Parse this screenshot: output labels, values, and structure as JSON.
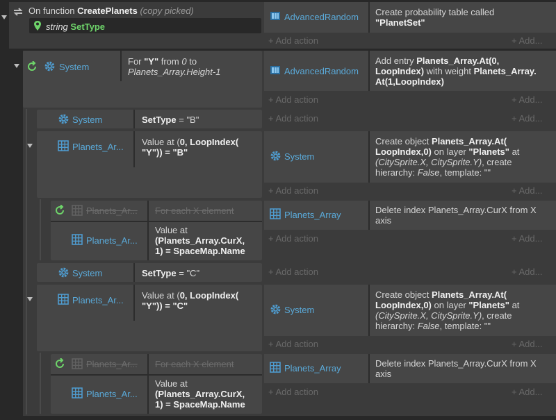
{
  "function_header": {
    "prefix": "On function ",
    "name": "CreatePlanets",
    "suffix": "(copy picked)",
    "param_type": "string",
    "param_name": "SetType",
    "action_object": "AdvancedRandom",
    "action_pre": "Create probability table called",
    "action_value": "\"PlanetSet\""
  },
  "add_action": "+ Add action",
  "add_dots": "+ Add...",
  "loop_event": {
    "object": "System",
    "c_pre": "For ",
    "c_var": "\"Y\"",
    "c_from": " from ",
    "c_zero": "0",
    "c_to": " to",
    "c_end": "Planets_Array.Height-1",
    "action_object": "AdvancedRandom",
    "a1_pre": "Add entry ",
    "a1_b": "Planets_Array.At(0,",
    "a2_b1": "LoopIndex)",
    "a2_mid": " with weight ",
    "a2_b2": "Planets_Array.",
    "a3_b": "At(1,LoopIndex)"
  },
  "event_b": {
    "object": "System",
    "var": "SetType",
    "op": " = ",
    "val": "\"B\""
  },
  "event_b_arr": {
    "object": "Planets_Ar...",
    "c1_pre": "Value at (",
    "c1_b": "0, LoopIndex(",
    "c2_b": "\"Y\")) = \"B\"",
    "action_object": "System",
    "a1_pre": "Create object ",
    "a1_b": "Planets_Array.At(",
    "a2_b": "LoopIndex,0)",
    "a2_mid": " on layer ",
    "a2_v": "\"Planets\"",
    "a2_post": " at",
    "a3_i": "(CitySprite.X, CitySprite.Y)",
    "a3_post": ", create",
    "a4_pre": "hierarchy: ",
    "a4_i": "False",
    "a4_post": ", template: \"\""
  },
  "foreach_b": {
    "object1": "Planets_Ar...",
    "cond1": "For each X element",
    "object2": "Planets_Ar...",
    "c2_1": "Value at",
    "c2_2": "(Planets_Array.CurX,",
    "c2_3": "1) = SpaceMap.Name",
    "action_object": "Planets_Array",
    "a1": "Delete index Planets_Array.CurX from X",
    "a2": "axis"
  },
  "event_c": {
    "object": "System",
    "var": "SetType",
    "op": " = ",
    "val": "\"C\""
  },
  "event_c_arr": {
    "object": "Planets_Ar...",
    "c1_pre": "Value at (",
    "c1_b": "0, LoopIndex(",
    "c2_b": "\"Y\")) = \"C\"",
    "action_object": "System",
    "a1_pre": "Create object ",
    "a1_b": "Planets_Array.At(",
    "a2_b": "LoopIndex,0)",
    "a2_mid": " on layer ",
    "a2_v": "\"Planets\"",
    "a2_post": " at",
    "a3_i": "(CitySprite.X, CitySprite.Y)",
    "a3_post": ", create",
    "a4_pre": "hierarchy: ",
    "a4_i": "False",
    "a4_post": ", template: \"\""
  },
  "foreach_c": {
    "object1": "Planets_Ar...",
    "cond1": "For each X element",
    "object2": "Planets_Ar...",
    "c2_1": "Value at",
    "c2_2": "(Planets_Array.CurX,",
    "c2_3": "1) = SpaceMap.Name",
    "action_object": "Planets_Array",
    "a1": "Delete index Planets_Array.CurX from X",
    "a2": "axis"
  }
}
